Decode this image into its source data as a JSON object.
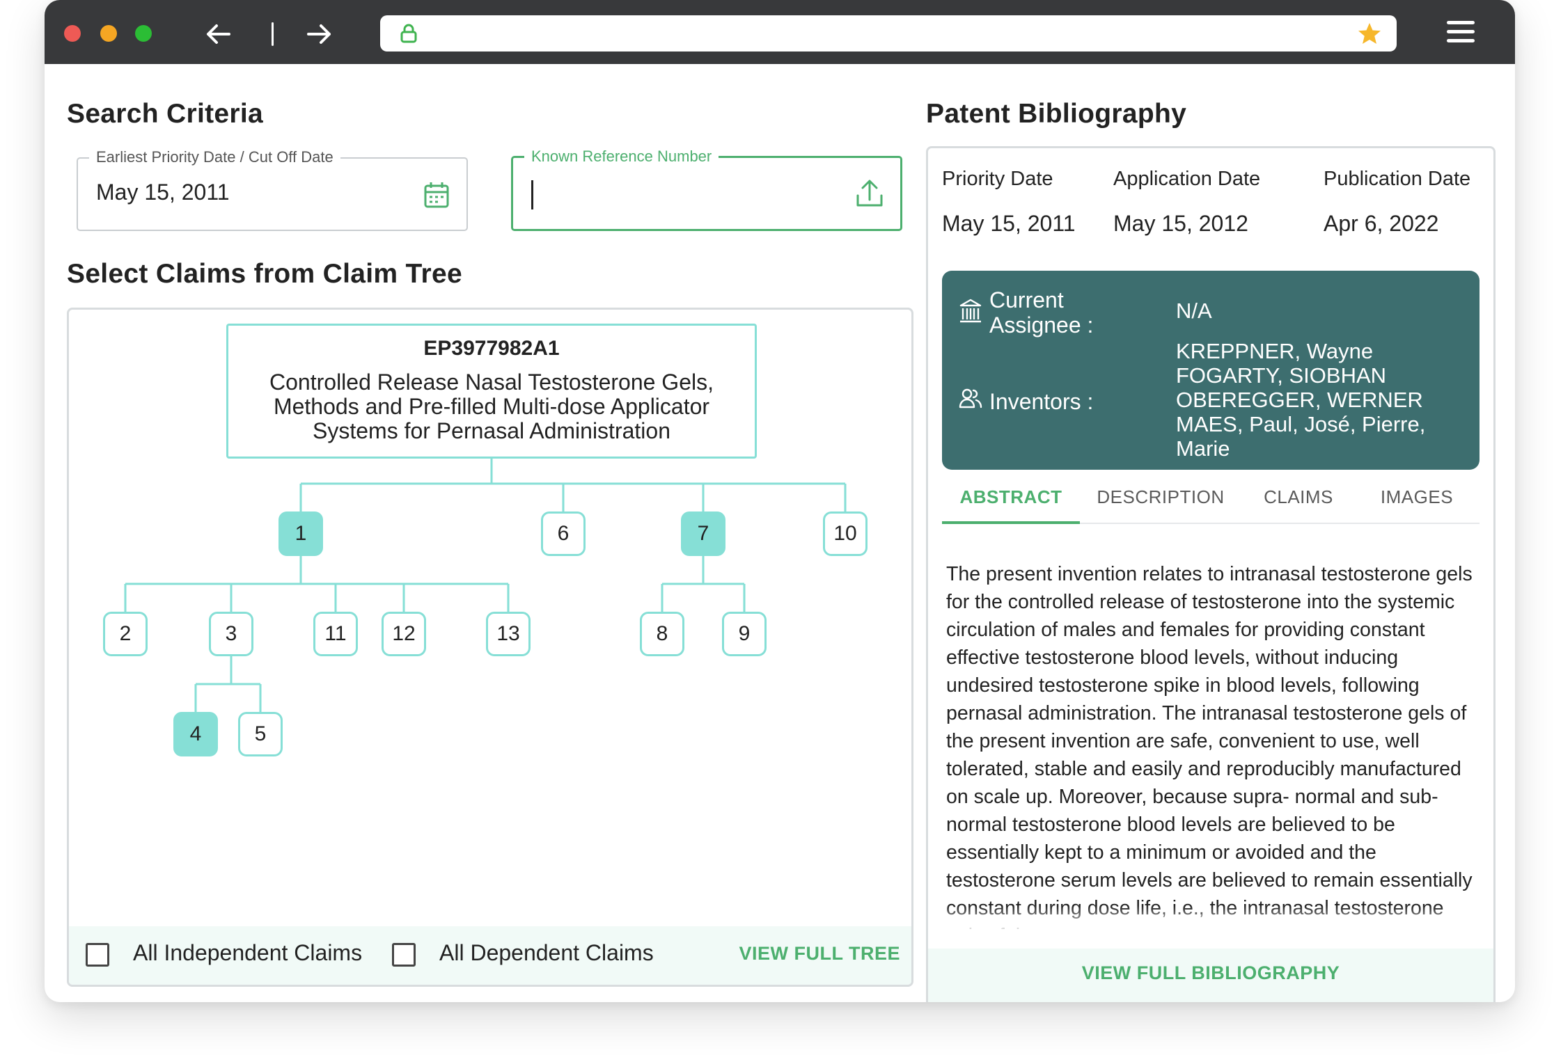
{
  "browser": {
    "colors": {
      "close": "#ee5a55",
      "minimize": "#f5a623",
      "maximize": "#2bbd35",
      "star": "#f6b72b"
    },
    "icons": [
      "back-arrow-icon",
      "forward-arrow-icon",
      "lock-icon",
      "star-icon",
      "hamburger-menu-icon"
    ]
  },
  "search": {
    "title": "Search Criteria",
    "priority_field": {
      "label": "Earliest Priority Date / Cut Off Date",
      "value": "May 15, 2011",
      "icon": "calendar-icon"
    },
    "reference_field": {
      "label": "Known Reference Number",
      "value": "",
      "icon": "upload-icon"
    }
  },
  "claims": {
    "title": "Select Claims from Claim Tree",
    "root": {
      "id": "EP3977982A1",
      "title": "Controlled Release Nasal Testosterone Gels, Methods and Pre-filled Multi-dose Applicator Systems for Pernasal Administration"
    },
    "nodes": {
      "n1": "1",
      "n2": "2",
      "n3": "3",
      "n4": "4",
      "n5": "5",
      "n6": "6",
      "n7": "7",
      "n8": "8",
      "n9": "9",
      "n10": "10",
      "n11": "11",
      "n12": "12",
      "n13": "13"
    },
    "selected": [
      "1",
      "7",
      "4"
    ],
    "footer": {
      "independent_label": "All Independent Claims",
      "dependent_label": "All Dependent Claims",
      "view_tree": "VIEW FULL TREE"
    },
    "colors": {
      "accent": "#86dfd6",
      "link": "#4caf6e"
    }
  },
  "bibliography": {
    "title": "Patent Bibliography",
    "dates": {
      "priority": {
        "label": "Priority Date",
        "value": "May 15, 2011"
      },
      "application": {
        "label": "Application Date",
        "value": "May 15, 2012"
      },
      "publication": {
        "label": "Publication Date",
        "value": "Apr 6, 2022"
      }
    },
    "assignee": {
      "label_line1": "Current",
      "label_line2": "Assignee :",
      "value": "N/A",
      "icon": "building-icon"
    },
    "inventors": {
      "label": "Inventors :",
      "icon": "users-icon",
      "lines": [
        "KREPPNER, Wayne",
        "FOGARTY, SIOBHAN",
        "OBEREGGER, WERNER",
        "MAES, Paul, José, Pierre,",
        "Marie"
      ]
    },
    "tabs": [
      "ABSTRACT",
      "DESCRIPTION",
      "CLAIMS",
      "IMAGES"
    ],
    "active_tab": "ABSTRACT",
    "abstract": "The present invention relates to intranasal testosterone gels for the controlled release of testosterone into the systemic circulation of males and females for providing constant effective testosterone blood levels, without inducing undesired testosterone spike in blood levels, following pernasal administration. The intranasal testosterone gels of the present invention are safe, convenient to use, well tolerated, stable and easily and reproducibly manufactured on scale up. Moreover, because supra- normal and sub-normal testosterone blood levels are believed to be essentially kept to a minimum or avoided and the testosterone serum levels are believed to remain essentially constant during dose life, i.e., the intranasal testosterone gels of the present",
    "view_full": "VIEW FULL BIBLIOGRAPHY",
    "colors": {
      "panel": "#3d6e6f",
      "accent": "#4caf6e"
    }
  }
}
